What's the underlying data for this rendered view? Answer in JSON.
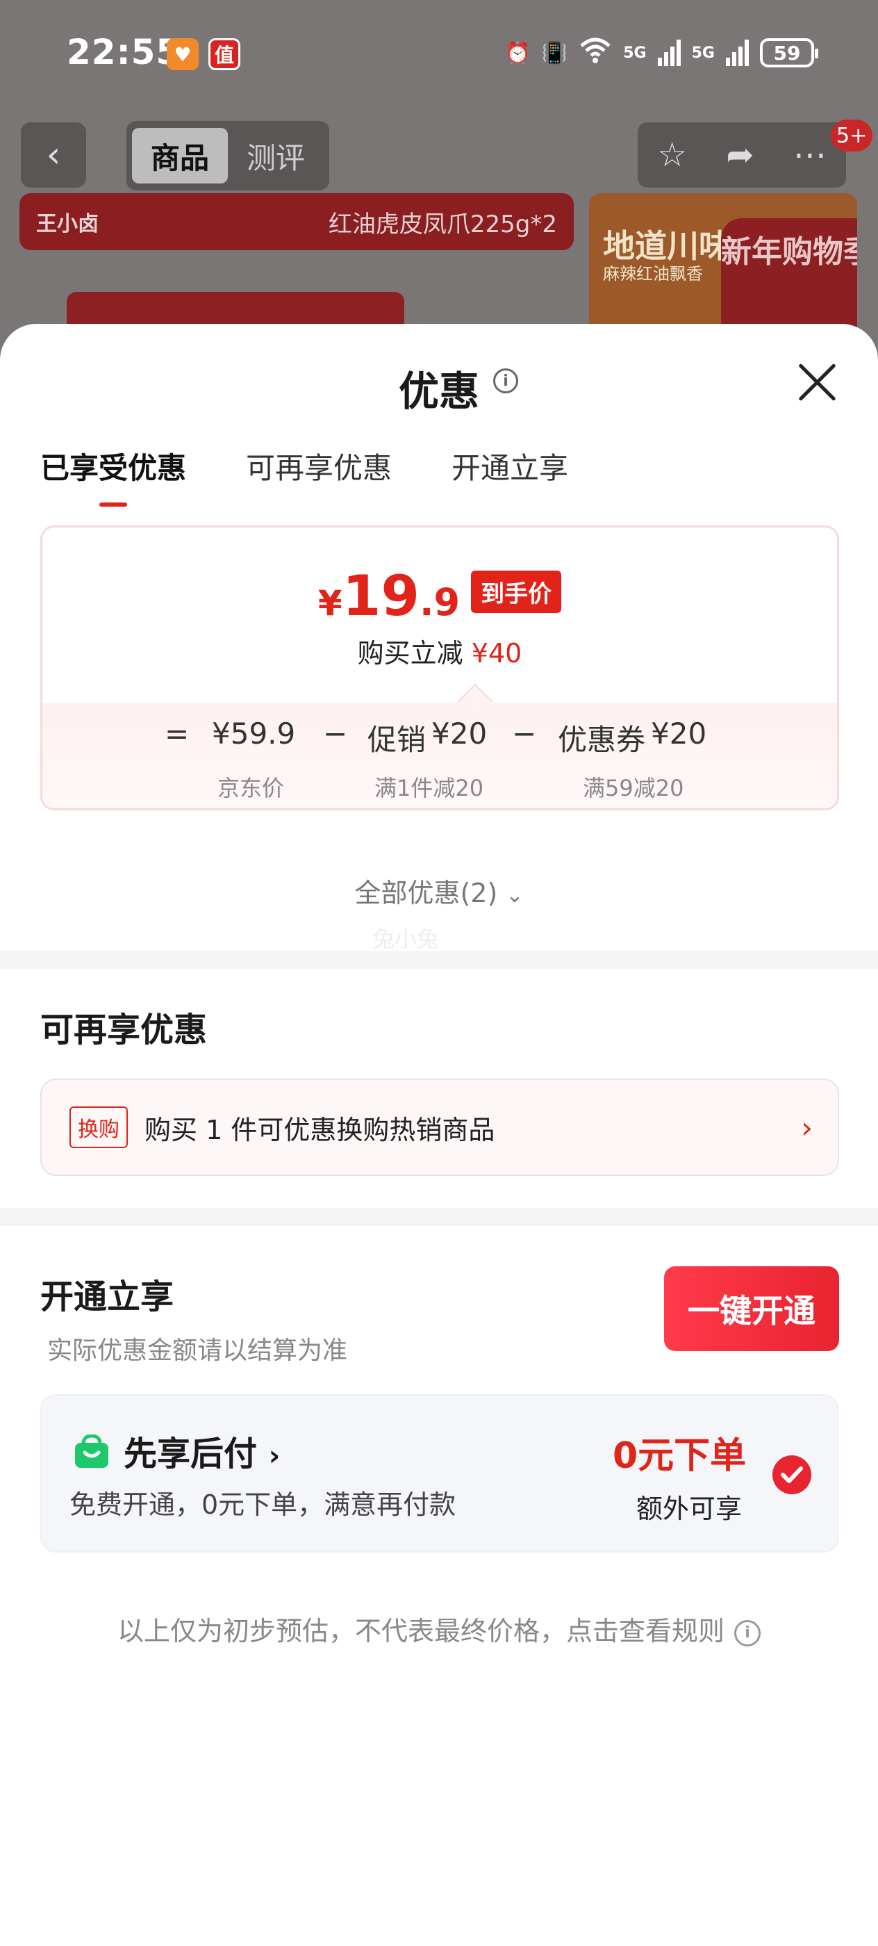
{
  "status_bar": {
    "time": "22:55",
    "app_badge_1": "heart-app-icon",
    "app_badge_2": "值",
    "network_1": "5G",
    "network_2": "5G",
    "battery": "59"
  },
  "background_page": {
    "tabs": [
      "商品",
      "测评"
    ],
    "active_tab": "商品",
    "more_badge": "5+",
    "brand_logo": "王小卤",
    "product_title": "红油虎皮凤爪225g*2",
    "side_card_title": "地道川味",
    "side_card_subtitle": "麻辣红油飘香",
    "side_card_promo": "新年购物季"
  },
  "sheet": {
    "title": "优惠",
    "info_icon": "i",
    "tabs": [
      "已享受优惠",
      "可再享优惠",
      "开通立享"
    ],
    "active_tab_index": 0
  },
  "price_card": {
    "currency": "¥",
    "price_int": "19",
    "price_dec": ".9",
    "price_tag": "到手价",
    "save_label": "购买立减",
    "save_amount": "¥40",
    "equals": "=",
    "minus": "−",
    "base_price": "¥59.9",
    "base_label": "京东价",
    "promo_label": "促销",
    "promo_amount": "¥20",
    "promo_sub": "满1件减20",
    "coupon_label": "优惠券",
    "coupon_amount": "¥20",
    "coupon_sub": "满59减20"
  },
  "all_discounts": "全部优惠(2)",
  "watermark": "兔小兔",
  "reenjoy": {
    "title": "可再享优惠",
    "tag": "换购",
    "text": "购买 1 件可优惠换购热销商品"
  },
  "enable": {
    "title": "开通立享",
    "subtitle": "实际优惠金额请以结算为准",
    "button": "一键开通",
    "pay_title": "先享后付",
    "pay_desc": "免费开通，0元下单，满意再付款",
    "pay_price": "0元下单",
    "pay_extra": "额外可享"
  },
  "footer_note": "以上仅为初步预估，不代表最终价格，点击查看规则",
  "colors": {
    "accent_red": "#e2231a",
    "overlay_gray": "#7b7676",
    "divider": "#f5f5f7",
    "pay_card_bg": "#f4f6fa",
    "bag_green": "#1ec96b"
  }
}
